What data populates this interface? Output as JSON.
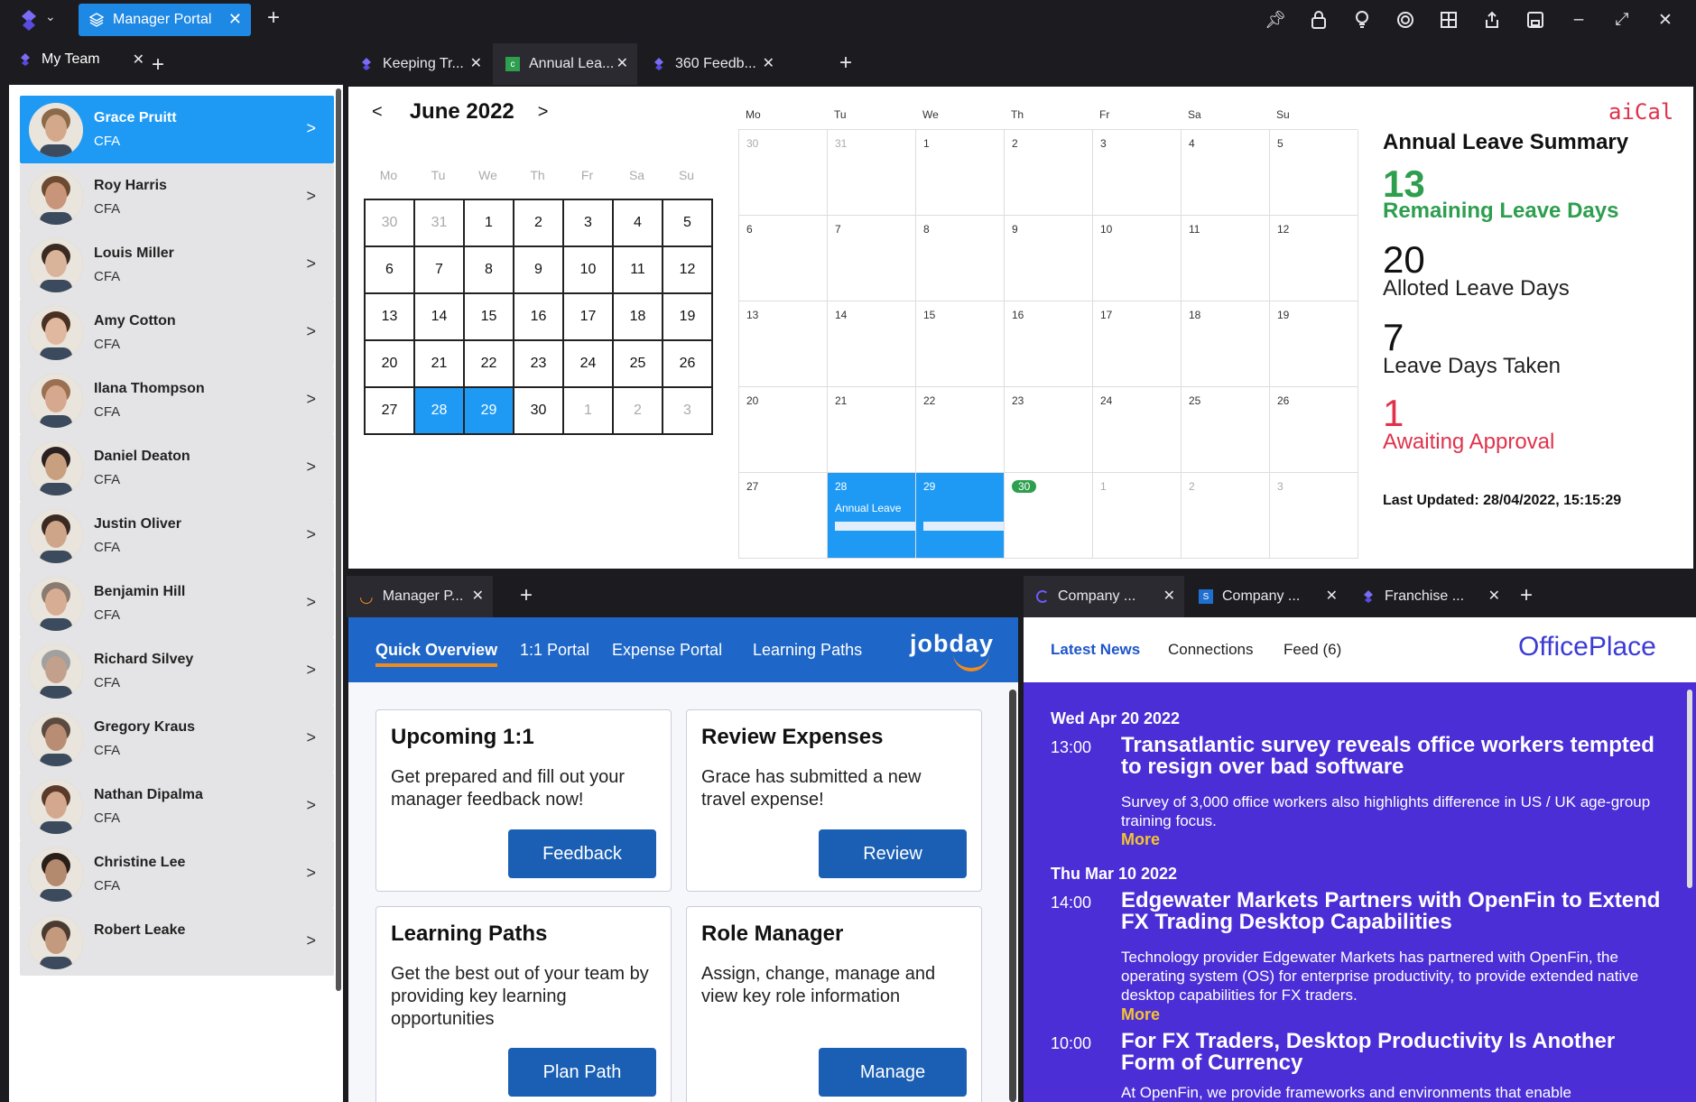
{
  "titlebar": {
    "tab_label": "Manager Portal",
    "icons": [
      "pin-icon",
      "lock-icon",
      "lightbulb-icon",
      "target-icon",
      "grid-icon",
      "share-icon",
      "save-icon",
      "minimize-icon",
      "maximize-icon",
      "close-icon"
    ]
  },
  "team": {
    "tab_label": "My Team",
    "members": [
      {
        "name": "Grace Pruitt",
        "role": "CFA"
      },
      {
        "name": "Roy Harris",
        "role": "CFA"
      },
      {
        "name": "Louis Miller",
        "role": "CFA"
      },
      {
        "name": "Amy Cotton",
        "role": "CFA"
      },
      {
        "name": "Ilana Thompson",
        "role": "CFA"
      },
      {
        "name": "Daniel Deaton",
        "role": "CFA"
      },
      {
        "name": "Justin Oliver",
        "role": "CFA"
      },
      {
        "name": "Benjamin Hill",
        "role": "CFA"
      },
      {
        "name": "Richard Silvey",
        "role": "CFA"
      },
      {
        "name": "Gregory Kraus",
        "role": "CFA"
      },
      {
        "name": "Nathan Dipalma",
        "role": "CFA"
      },
      {
        "name": "Christine Lee",
        "role": "CFA"
      },
      {
        "name": "Robert Leake",
        "role": ""
      }
    ],
    "arrow": ">"
  },
  "upper": {
    "tabs": [
      "Keeping Tr...",
      "Annual Lea...",
      "360 Feedb..."
    ],
    "month_label": "June 2022",
    "prev": "<",
    "next": ">",
    "mini_dows": [
      "Mo",
      "Tu",
      "We",
      "Th",
      "Fr",
      "Sa",
      "Su"
    ],
    "big_dows": [
      "Mo",
      "Tu",
      "We",
      "Th",
      "Fr",
      "Sa",
      "Su"
    ],
    "days": [
      "30",
      "31",
      "1",
      "2",
      "3",
      "4",
      "5",
      "6",
      "7",
      "8",
      "9",
      "10",
      "11",
      "12",
      "13",
      "14",
      "15",
      "16",
      "17",
      "18",
      "19",
      "20",
      "21",
      "22",
      "23",
      "24",
      "25",
      "26",
      "27",
      "28",
      "29",
      "30",
      "1",
      "2",
      "3"
    ],
    "leave_label": "Annual Leave",
    "brand": "aiCal",
    "summary": {
      "title": "Annual Leave Summary",
      "remaining_value": "13",
      "remaining_label": "Remaining Leave Days",
      "alloted_value": "20",
      "alloted_label": "Alloted Leave Days",
      "taken_value": "7",
      "taken_label": "Leave Days Taken",
      "awaiting_value": "1",
      "awaiting_label": "Awaiting Approval",
      "updated": "Last Updated: 28/04/2022, 15:15:29"
    }
  },
  "jobday": {
    "tab_label": "Manager P...",
    "nav": [
      "Quick Overview",
      "1:1 Portal",
      "Expense Portal",
      "Learning Paths"
    ],
    "logo": "jobday",
    "cards": [
      {
        "title": "Upcoming 1:1",
        "text": "Get prepared and fill out your manager feedback now!",
        "button": "Feedback"
      },
      {
        "title": "Review Expenses",
        "text": "Grace has submitted a new travel expense!",
        "button": "Review"
      },
      {
        "title": "Learning Paths",
        "text": "Get the best out of your team by providing key learning opportunities",
        "button": "Plan Path"
      },
      {
        "title": "Role Manager",
        "text": "Assign, change, manage and view key role information",
        "button": "Manage"
      }
    ]
  },
  "officeplace": {
    "tabs": [
      "Company ...",
      "Company ...",
      "Franchise ..."
    ],
    "nav": [
      "Latest News",
      "Connections",
      "Feed (6)"
    ],
    "logo": "OfficePlace",
    "more": "More",
    "news": [
      {
        "date": "Wed Apr 20 2022",
        "time": "13:00",
        "title": "Transatlantic survey reveals office workers tempted to resign over bad software",
        "body": "Survey of 3,000 office workers also highlights difference in US / UK age-group training focus."
      },
      {
        "date": "Thu Mar 10 2022",
        "time": "14:00",
        "title": "Edgewater Markets Partners with OpenFin to Extend FX Trading Desktop Capabilities",
        "body": "Technology provider Edgewater Markets has partnered with OpenFin, the operating system (OS) for enterprise productivity, to provide extended native desktop capabilities for FX traders."
      },
      {
        "date": "",
        "time": "10:00",
        "title": "For FX Traders, Desktop Productivity Is Another Form of Currency",
        "body": "At OpenFin, we provide frameworks and environments that enable"
      }
    ]
  }
}
